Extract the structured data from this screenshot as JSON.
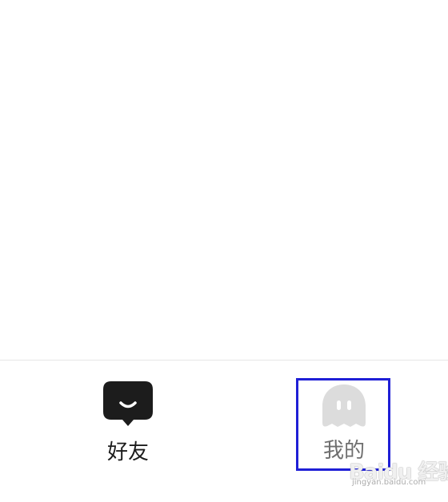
{
  "tabbar": {
    "tabs": [
      {
        "label": "好友",
        "icon": "chat-bubble-smile-icon",
        "active": true
      },
      {
        "label": "我的",
        "icon": "ghost-avatar-icon",
        "active": false
      }
    ]
  },
  "annotation": {
    "highlight_color": "#1f1fd6",
    "highlight_target": "我的"
  },
  "watermark": {
    "logo": "Baidu 经验",
    "url": "jingyan.baidu.com"
  }
}
